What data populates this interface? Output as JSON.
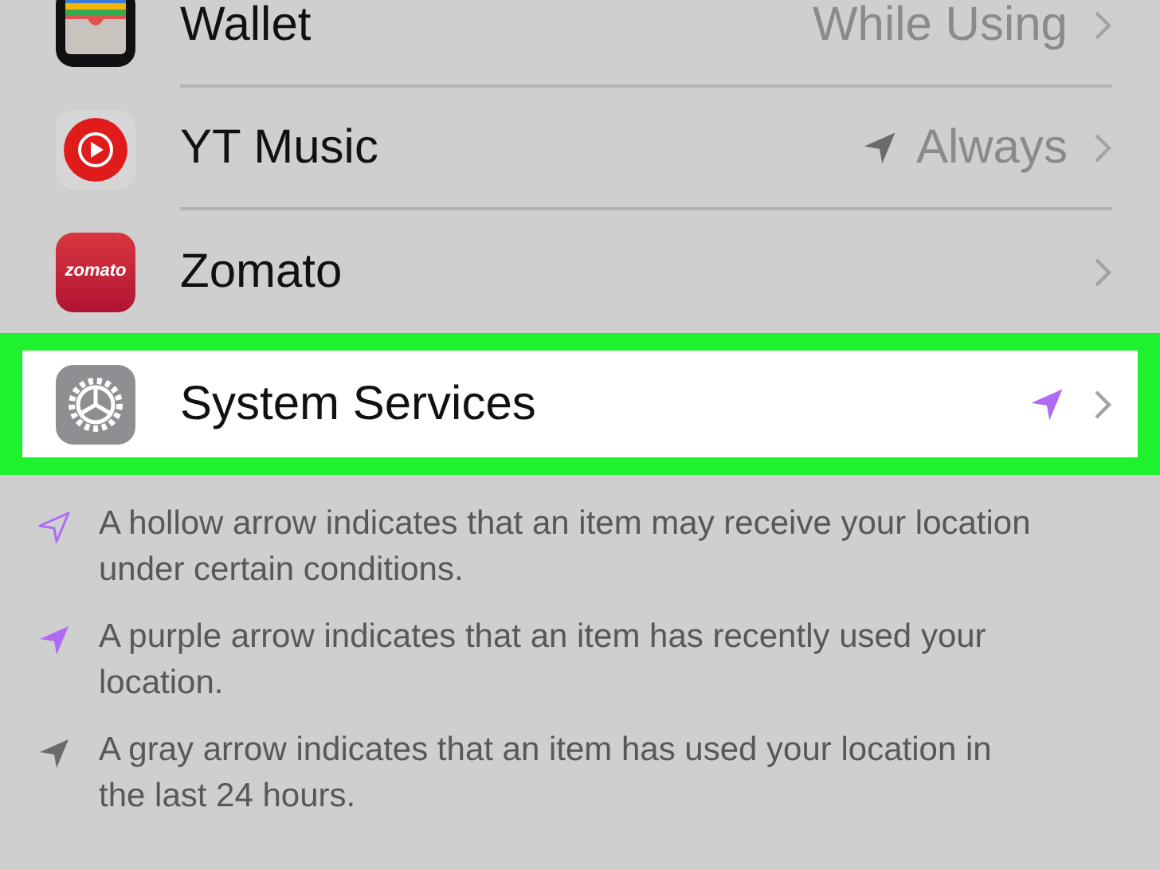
{
  "rows": [
    {
      "kind": "wallet",
      "label": "Wallet",
      "value": "While Using",
      "highlighted": false
    },
    {
      "kind": "music",
      "label": "YT Music",
      "value": "Always",
      "arrow": {
        "color": "#6b6b6b"
      },
      "highlighted": false
    },
    {
      "kind": "logo",
      "logo_text": "zomato",
      "label": "Zomato",
      "highlighted": false
    },
    {
      "kind": "gear",
      "label": "System Services",
      "arrow": {
        "color": "#b06af5"
      },
      "highlighted": true
    }
  ],
  "notes": [
    {
      "arrow": {
        "color": "#b06af5",
        "hollow": true
      },
      "text": "A hollow arrow indicates that an item may receive your location under certain conditions."
    },
    {
      "arrow": {
        "color": "#b06af5",
        "hollow": false
      },
      "text": "A purple arrow indicates that an item has recently used your location."
    },
    {
      "arrow": {
        "color": "#6b6b6b",
        "hollow": false
      },
      "text": "A gray arrow indicates that an item has used your location in the last 24 hours."
    }
  ]
}
